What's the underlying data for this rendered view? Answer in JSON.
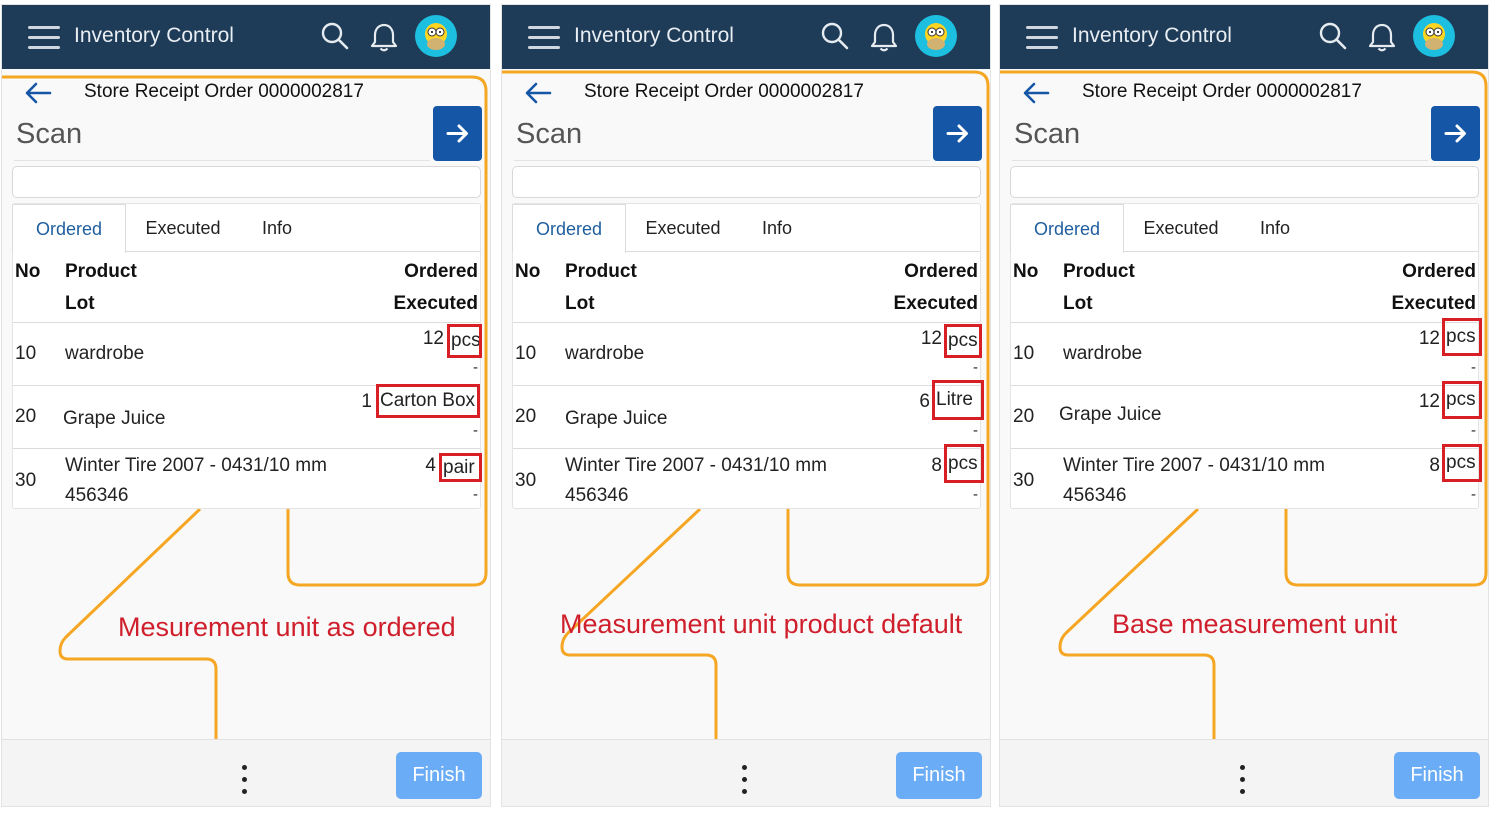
{
  "app_title": "Inventory Control",
  "order_title": "Store Receipt Order 0000002817",
  "scan_label": "Scan",
  "tabs": [
    "Ordered",
    "Executed",
    "Info"
  ],
  "table_headers": {
    "no": "No",
    "product": "Product",
    "lot": "Lot",
    "ordered": "Ordered",
    "executed": "Executed"
  },
  "finish_label": "Finish",
  "accent_colors": {
    "header": "#1e3b57",
    "primary_button": "#1557a6",
    "finish_button": "#6aacf5",
    "highlight": "#d91f26",
    "connector": "#f5a623"
  },
  "icons": [
    "menu-icon",
    "search-icon",
    "bell-icon",
    "avatar",
    "back-arrow-icon",
    "arrow-right-icon",
    "more-vertical-icon"
  ],
  "panels": [
    {
      "caption": "Mesurement unit as ordered",
      "rows": [
        {
          "no": "10",
          "product": "wardrobe",
          "lot": "",
          "ordered_qty": "12",
          "unit": "pcs",
          "executed": "-"
        },
        {
          "no": "20",
          "product": "Grape Juice",
          "lot": "",
          "ordered_qty": "1",
          "unit": "Carton Box",
          "executed": "-"
        },
        {
          "no": "30",
          "product": "Winter Tire 2007 - 0431/10 mm",
          "lot": "456346",
          "ordered_qty": "4",
          "unit": "pair",
          "executed": "-"
        }
      ]
    },
    {
      "caption": "Measurement unit product default",
      "rows": [
        {
          "no": "10",
          "product": "wardrobe",
          "lot": "",
          "ordered_qty": "12",
          "unit": "pcs",
          "executed": "-"
        },
        {
          "no": "20",
          "product": "Grape Juice",
          "lot": "",
          "ordered_qty": "6",
          "unit": "Litre",
          "executed": "-"
        },
        {
          "no": "30",
          "product": "Winter Tire 2007 - 0431/10 mm",
          "lot": "456346",
          "ordered_qty": "8",
          "unit": "pcs",
          "executed": "-"
        }
      ]
    },
    {
      "caption": "Base measurement unit",
      "rows": [
        {
          "no": "10",
          "product": "wardrobe",
          "lot": "",
          "ordered_qty": "12",
          "unit": "pcs",
          "executed": "-"
        },
        {
          "no": "20",
          "product": "Grape Juice",
          "lot": "",
          "ordered_qty": "12",
          "unit": "pcs",
          "executed": "-"
        },
        {
          "no": "30",
          "product": "Winter Tire 2007 - 0431/10 mm",
          "lot": "456346",
          "ordered_qty": "8",
          "unit": "pcs",
          "executed": "-"
        }
      ]
    }
  ]
}
